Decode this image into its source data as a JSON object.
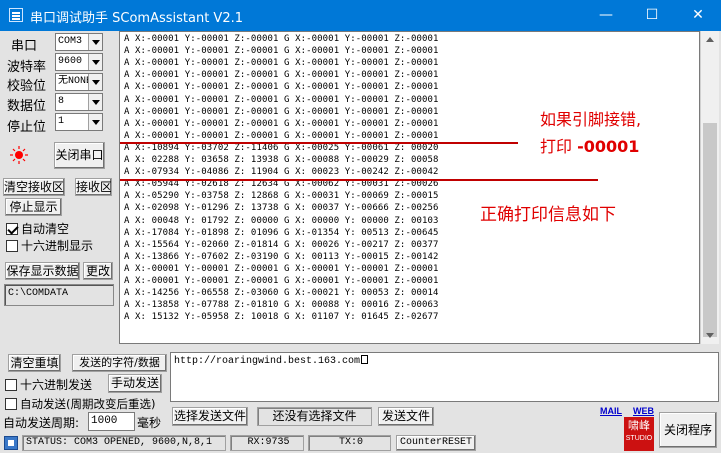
{
  "window": {
    "title": "串口调试助手 SComAssistant V2.1",
    "min": "—",
    "max": "☐",
    "close": "✕"
  },
  "left": {
    "port_label": "串口",
    "port_value": "COM3",
    "baud_label": "波特率",
    "baud_value": "9600",
    "parity_label": "校验位",
    "parity_value": "无NONE",
    "databits_label": "数据位",
    "databits_value": "8",
    "stopbits_label": "停止位",
    "stopbits_value": "1",
    "close_port_button": "关闭串口",
    "clear_recv_button": "清空接收区",
    "recv_area_button": "接收区",
    "stop_display_button": "停止显示",
    "auto_clear_label": "自动清空",
    "auto_clear_checked": true,
    "hex_display_label": "十六进制显示",
    "hex_display_checked": false,
    "save_display_button": "保存显示数据",
    "change_button": "更改",
    "path": "C:\\COMDATA"
  },
  "receive": {
    "lines": [
      "A X:-00001 Y:-00001 Z:-00001 G X:-00001 Y:-00001 Z:-00001",
      "A X:-00001 Y:-00001 Z:-00001 G X:-00001 Y:-00001 Z:-00001",
      "A X:-00001 Y:-00001 Z:-00001 G X:-00001 Y:-00001 Z:-00001",
      "A X:-00001 Y:-00001 Z:-00001 G X:-00001 Y:-00001 Z:-00001",
      "A X:-00001 Y:-00001 Z:-00001 G X:-00001 Y:-00001 Z:-00001",
      "A X:-00001 Y:-00001 Z:-00001 G X:-00001 Y:-00001 Z:-00001",
      "A X:-00001 Y:-00001 Z:-00001 G X:-00001 Y:-00001 Z:-00001",
      "A X:-00001 Y:-00001 Z:-00001 G X:-00001 Y:-00001 Z:-00001",
      "A X:-00001 Y:-00001 Z:-00001 G X:-00001 Y:-00001 Z:-00001",
      "A X:-10894 Y:-03702 Z:-11406 G X:-00025 Y:-00061 Z: 00020",
      "A X: 02288 Y: 03658 Z: 13938 G X:-00088 Y:-00029 Z: 00058",
      "A X:-07934 Y:-04086 Z: 11904 G X: 00023 Y:-00242 Z:-00042",
      "A X:-05944 Y:-02618 Z: 12634 G X:-00062 Y:-00031 Z:-00026",
      "A X:-05290 Y:-03758 Z: 12868 G X:-00031 Y:-00069 Z:-00015",
      "A X:-02098 Y:-01296 Z: 13738 G X: 00037 Y:-00666 Z:-00256",
      "A X: 00048 Y: 01792 Z: 00000 G X: 00000 Y: 00000 Z: 00103",
      "A X:-17084 Y:-01898 Z: 01096 G X:-01354 Y: 00513 Z:-00645",
      "A X:-15564 Y:-02060 Z:-01814 G X: 00026 Y:-00217 Z: 00377",
      "A X:-13866 Y:-07602 Z:-03190 G X: 00113 Y:-00015 Z:-00142",
      "A X:-00001 Y:-00001 Z:-00001 G X:-00001 Y:-00001 Z:-00001",
      "A X:-00001 Y:-00001 Z:-00001 G X:-00001 Y:-00001 Z:-00001",
      "A X:-14256 Y:-06558 Z:-03060 G X:-00021 Y: 00053 Z: 00014",
      "A X:-13858 Y:-07788 Z:-01810 G X: 00088 Y: 00016 Z:-00063",
      "A X: 15132 Y:-05958 Z: 10018 G X: 01107 Y: 01645 Z:-02677"
    ]
  },
  "annotations": {
    "wrong_line1": "如果引脚接错,",
    "wrong_line2_prefix": "打印 ",
    "wrong_line2_value": "-00001",
    "correct": "正确打印信息如下"
  },
  "send": {
    "clear_button": "清空重填",
    "sent_chars_button": "发送的字符/数据",
    "hex_send_label": "十六进制发送",
    "hex_send_checked": false,
    "manual_send_button": "手动发送",
    "auto_send_label": "自动发送(周期改变后重选)",
    "auto_send_checked": false,
    "period_label": "自动发送周期:",
    "period_value": "1000",
    "period_unit": "毫秒",
    "text": "http://roaringwind.best.163.com",
    "choose_file_button": "选择发送文件",
    "file_status": "还没有选择文件",
    "send_file_button": "发送文件",
    "mail_link": "MAIL",
    "web_link": "WEB",
    "logo_text": "啸峰",
    "logo_sub": "STUDIO",
    "quit_button": "关闭程序"
  },
  "status": {
    "state": "STATUS: COM3 OPENED, 9600,N,8,1",
    "rx": "RX:9735",
    "tx": "TX:0",
    "reset_button": "CounterRESET"
  },
  "colors": {
    "titlebar": "#0078d7",
    "annotation": "#e00000",
    "indicator": "#ff0000"
  }
}
